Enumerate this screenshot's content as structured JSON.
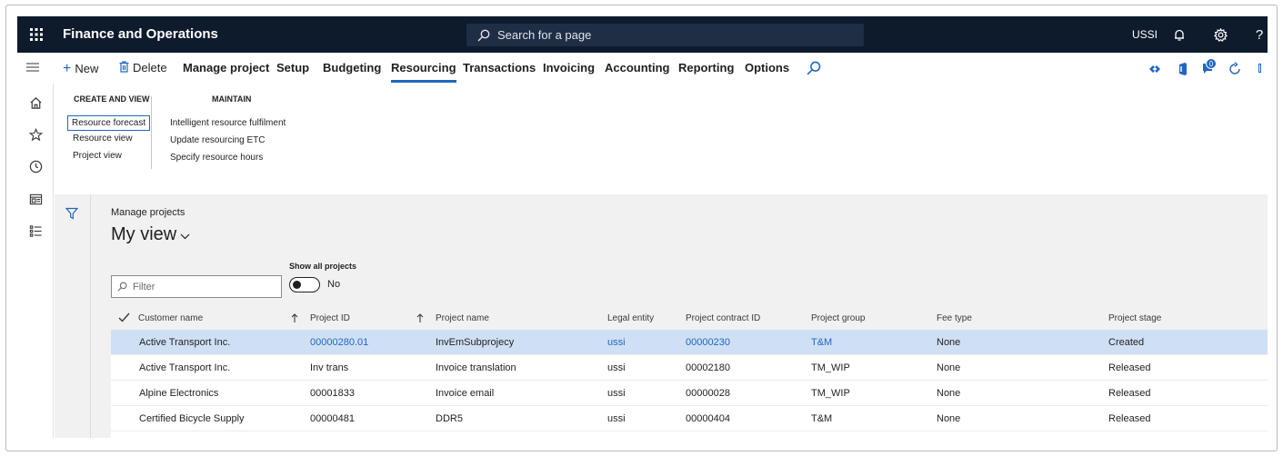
{
  "app": {
    "title": "Finance and Operations",
    "search_placeholder": "Search for a page",
    "company": "USSI"
  },
  "actions": {
    "new": "New",
    "delete": "Delete",
    "tabs": [
      "Manage project",
      "Setup",
      "Budgeting",
      "Resourcing",
      "Transactions",
      "Invoicing",
      "Accounting",
      "Reporting",
      "Options"
    ],
    "active_tab": "Resourcing",
    "badge_count": "0"
  },
  "ribbon": {
    "group1": {
      "header": "CREATE AND VIEW",
      "items": [
        "Resource forecast",
        "Resource view",
        "Project view"
      ]
    },
    "group2": {
      "header": "MAINTAIN",
      "items": [
        "Intelligent resource fulfilment",
        "Update resourcing ETC",
        "Specify resource hours"
      ]
    }
  },
  "page": {
    "caption": "Manage projects",
    "view": "My view",
    "filter_placeholder": "Filter",
    "toggle_label": "Show all projects",
    "toggle_value": "No"
  },
  "grid": {
    "columns": [
      "Customer name",
      "Project ID",
      "Project name",
      "Legal entity",
      "Project contract ID",
      "Project group",
      "Fee type",
      "Project stage"
    ],
    "rows": [
      [
        "Active Transport Inc.",
        "00000280.01",
        "InvEmSubprojecy",
        "ussi",
        "00000230",
        "T&M",
        "None",
        "Created"
      ],
      [
        "Active Transport Inc.",
        "Inv trans",
        "Invoice translation",
        "ussi",
        "00002180",
        "TM_WIP",
        "None",
        "Released"
      ],
      [
        "Alpine Electronics",
        "00001833",
        "Invoice email",
        "ussi",
        "00000028",
        "TM_WIP",
        "None",
        "Released"
      ],
      [
        "Certified Bicycle Supply",
        "00000481",
        "DDR5",
        "ussi",
        "00000404",
        "T&M",
        "None",
        "Released"
      ]
    ]
  },
  "colors": {
    "topbar": "#0e1b2c",
    "accent": "#2266c0",
    "selected_row": "#cfe0f5"
  }
}
